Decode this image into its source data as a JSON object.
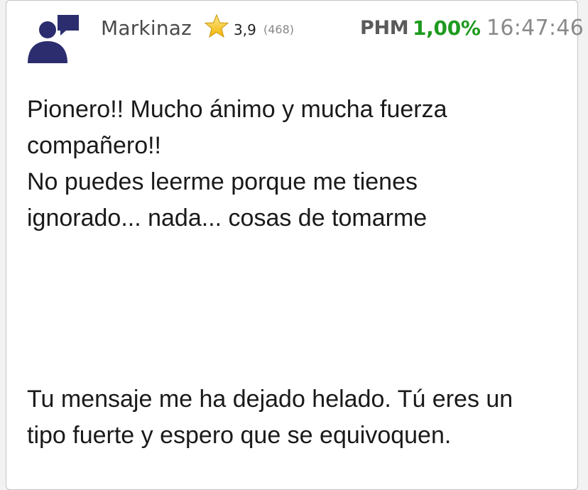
{
  "post": {
    "username": "Markinaz",
    "rating": "3,9",
    "rating_count": "(468)",
    "ticker": "PHM",
    "change": "1,00%",
    "time": "16:47:46",
    "quote_paragraph": "Pionero!! Mucho ánimo y mucha fuerza\ncompañero!!\nNo puedes leerme porque me tienes\nignorado... nada... cosas de tomarme",
    "reply_paragraph": "Tu mensaje me ha dejado helado. Tú eres un\ntipo fuerte y espero que se equivoquen."
  },
  "colors": {
    "avatar": "#2b2d6e",
    "star": "#f5c518",
    "change_positive": "#1e9a1e"
  },
  "icons": {
    "avatar": "user-avatar-icon",
    "star": "star-icon"
  }
}
